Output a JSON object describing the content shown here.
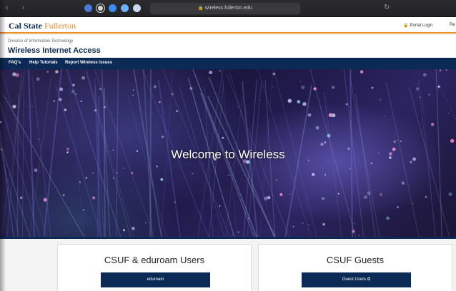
{
  "browser": {
    "back_label": "‹",
    "forward_label": "›",
    "url": "wireless.fullerton.edu",
    "reload_icon": "reload-icon"
  },
  "header": {
    "logo_part1": "Cal State ",
    "logo_part2": "Fullerton",
    "portal_login": "Portal Login",
    "truncated_link": "Re"
  },
  "site": {
    "division": "Division of Information Technology",
    "title": "Wireless Internet Access"
  },
  "nav": {
    "items": [
      {
        "label": "FAQ's"
      },
      {
        "label": "Help Tutorials"
      },
      {
        "label": "Report Wireless Issues"
      }
    ]
  },
  "hero": {
    "title": "Welcome to Wireless"
  },
  "cards": [
    {
      "title": "CSUF & eduroam Users",
      "button": "eduroam"
    },
    {
      "title": "CSUF Guests",
      "button": "Guest Users ⧉"
    }
  ],
  "colors": {
    "navy": "#0b2a55",
    "orange": "#f08a24"
  }
}
